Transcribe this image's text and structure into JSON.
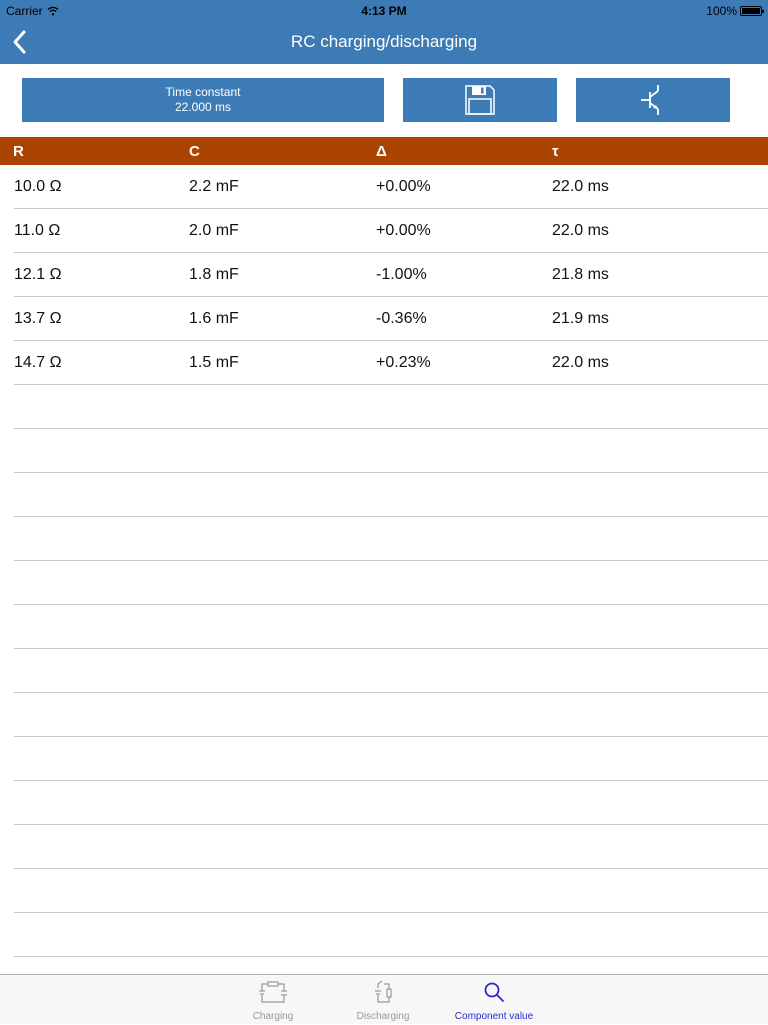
{
  "status_bar": {
    "carrier": "Carrier",
    "time": "4:13 PM",
    "battery": "100%"
  },
  "nav": {
    "title": "RC charging/discharging",
    "back_icon": "chevron-left-icon"
  },
  "toolbar": {
    "time_constant_label": "Time constant",
    "time_constant_value": "22.000 ms",
    "save_icon": "floppy-disk-icon",
    "transistor_icon": "transistor-icon"
  },
  "table": {
    "headers": [
      "R",
      "C",
      "Δ",
      "τ"
    ],
    "rows": [
      [
        "10.0 Ω",
        "2.2 mF",
        "+0.00%",
        "22.0 ms"
      ],
      [
        "11.0 Ω",
        "2.0 mF",
        "+0.00%",
        "22.0 ms"
      ],
      [
        "12.1 Ω",
        "1.8 mF",
        "-1.00%",
        "21.8 ms"
      ],
      [
        "13.7 Ω",
        "1.6 mF",
        "-0.36%",
        "21.9 ms"
      ],
      [
        "14.7 Ω",
        "1.5 mF",
        "+0.23%",
        "22.0 ms"
      ]
    ]
  },
  "tabs": [
    {
      "label": "Charging",
      "icon": "charging-circuit-icon",
      "active": false
    },
    {
      "label": "Discharging",
      "icon": "discharging-circuit-icon",
      "active": false
    },
    {
      "label": "Component value",
      "icon": "search-icon",
      "active": true
    }
  ],
  "colors": {
    "header": "#3d7bb6",
    "column_header": "#aa4400",
    "active_tab": "#2a2ad0",
    "inactive_tab": "#999999"
  }
}
